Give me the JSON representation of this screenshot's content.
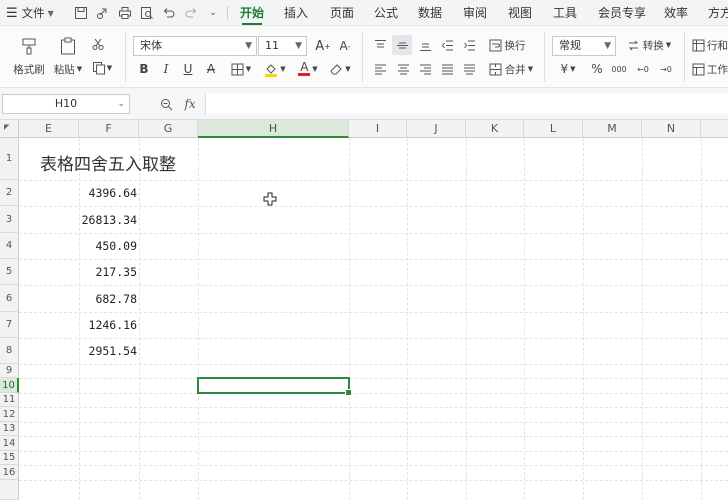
{
  "menu": {
    "file_label": "文件",
    "tabs": [
      "开始",
      "插入",
      "页面",
      "公式",
      "数据",
      "审阅",
      "视图",
      "工具",
      "会员专享",
      "效率",
      "方方"
    ],
    "active_tab": "开始"
  },
  "ribbon": {
    "format_painter": "格式刷",
    "paste": "粘贴",
    "font_name": "宋体",
    "font_size": "11",
    "wrap_text": "换行",
    "merge": "合并",
    "number_format": "常规",
    "convert": "转换",
    "row_col": "行和",
    "worksheet": "工作"
  },
  "formula_bar": {
    "name_box": "H10",
    "fx": "fx",
    "content": ""
  },
  "grid": {
    "columns": [
      "E",
      "F",
      "G",
      "H",
      "I",
      "J",
      "K",
      "L",
      "M",
      "N"
    ],
    "selected_column": "H",
    "rows": [
      "1",
      "2",
      "3",
      "4",
      "5",
      "6",
      "7",
      "8",
      "9",
      "10",
      "11",
      "12",
      "13",
      "14",
      "15",
      "16"
    ],
    "selected_row": "10",
    "title": "表格四舍五入取整",
    "values": [
      "4396.64",
      "26813.34",
      "450.09",
      "217.35",
      "682.78",
      "1246.16",
      "2951.54"
    ]
  }
}
